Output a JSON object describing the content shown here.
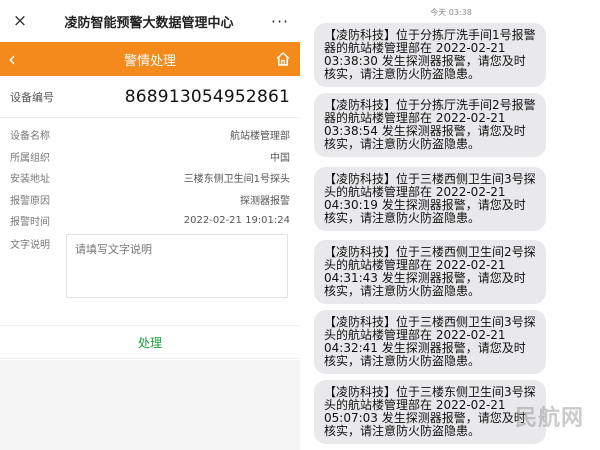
{
  "app": {
    "title": "凌防智能预警大数据管理中心",
    "close_icon": "×",
    "more_icon": "···"
  },
  "header": {
    "title": "警情处理",
    "back_icon": "‹"
  },
  "device": {
    "label": "设备编号",
    "value": "86891305495286​1"
  },
  "info": [
    {
      "label": "设备名称",
      "value": "航站楼管理部"
    },
    {
      "label": "所属组织",
      "value": "中国"
    },
    {
      "label": "安装地址",
      "value": "三楼东侧卫生间1号探头"
    },
    {
      "label": "报警原因",
      "value": "探测器报警"
    },
    {
      "label": "报警时间",
      "value": "2022-02-21 19:01:24"
    }
  ],
  "note": {
    "label": "文字说明",
    "placeholder": "请填写文字说明"
  },
  "action": {
    "label": "处理"
  },
  "sms": {
    "time": "今天 03:38",
    "messages": [
      "【凌防科技】位于分拣厅洗手间1号报警器的航站楼管理部在 2022-02-21 03:38:30 发生探测器报警，请您及时核实，请注意防火防盗隐患。",
      "【凌防科技】位于分拣厅洗手间2号报警器的航站楼管理部在 2022-02-21 03:38:54 发生探测器报警，请您及时核实，请注意防火防盗隐患。",
      "【凌防科技】位于三楼西侧卫生间3号探头的航站楼管理部在 2022-02-21 04:30:19 发生探测器报警，请您及时核实，请注意防火防盗隐患。",
      "【凌防科技】位于三楼西侧卫生间2号探头的航站楼管理部在 2022-02-21 04:31:43 发生探测器报警，请您及时核实，请注意防火防盗隐患。",
      "【凌防科技】位于三楼西侧卫生间3号探头的航站楼管理部在 2022-02-21 04:32:41 发生探测器报警，请您及时核实，请注意防火防盗隐患。",
      "【凌防科技】位于三楼东侧卫生间3号探头的航站楼管理部在 2022-02-21 05:07:03 发生探测器报警，请您及时核实，请注意防火防盗隐患。"
    ]
  },
  "watermark": "民航网",
  "colors": {
    "accent": "#f48a1b",
    "action": "#1aa23a",
    "bubble": "#e9e9eb"
  }
}
